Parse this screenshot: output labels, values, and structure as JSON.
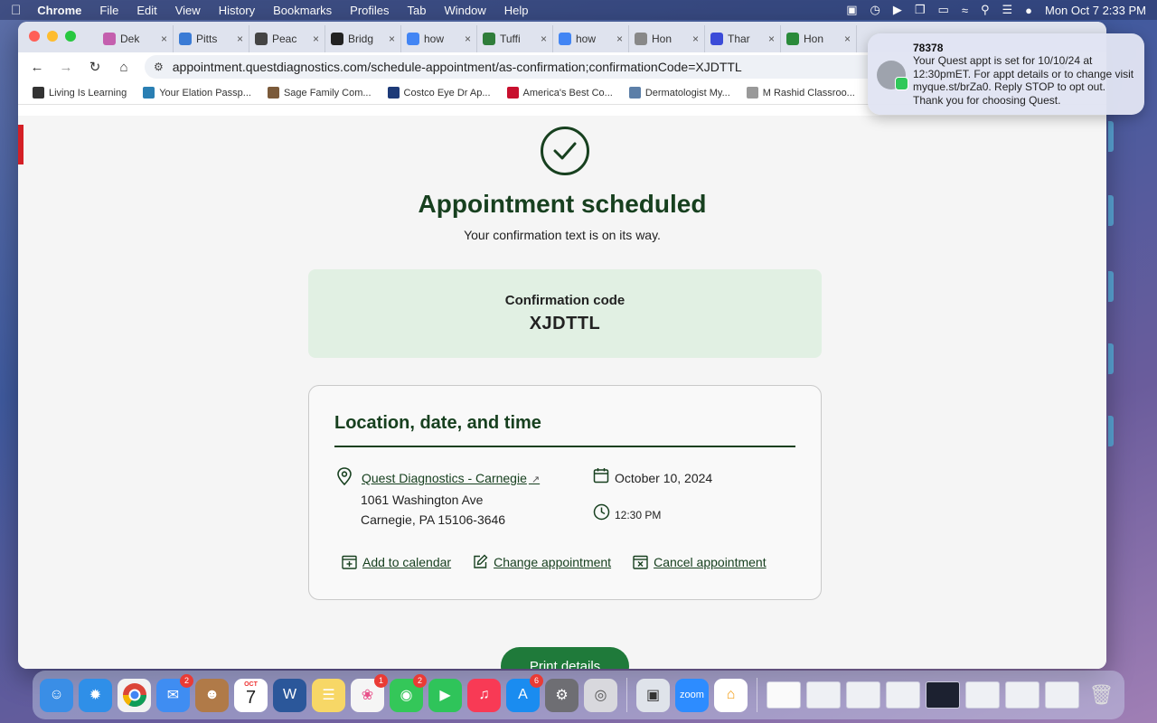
{
  "menubar": {
    "app_name": "Chrome",
    "menus": [
      "File",
      "Edit",
      "View",
      "History",
      "Bookmarks",
      "Profiles",
      "Tab",
      "Window",
      "Help"
    ],
    "clock": "Mon Oct 7  2:33 PM"
  },
  "browser": {
    "tabs": [
      {
        "title": "Dek",
        "fav_color": "#c45fae"
      },
      {
        "title": "Pitts",
        "fav_color": "#3a7bd5"
      },
      {
        "title": "Peac",
        "fav_color": "#444444"
      },
      {
        "title": "Bridg",
        "fav_color": "#222222"
      },
      {
        "title": "how",
        "fav_color": "#4285f4"
      },
      {
        "title": "Tuffi",
        "fav_color": "#2f7d3a"
      },
      {
        "title": "how",
        "fav_color": "#4285f4"
      },
      {
        "title": "Hon",
        "fav_color": "#888888"
      },
      {
        "title": "Thar",
        "fav_color": "#3b4bd8"
      },
      {
        "title": "Hon",
        "fav_color": "#2a8a3a"
      }
    ],
    "url": "appointment.questdiagnostics.com/schedule-appointment/as-confirmation;confirmationCode=XJDTTL",
    "bookmarks": [
      {
        "label": "Living Is Learning",
        "color": "#333333"
      },
      {
        "label": "Your Elation Passp...",
        "color": "#2a7fb3"
      },
      {
        "label": "Sage Family Com...",
        "color": "#7b5a3a"
      },
      {
        "label": "Costco Eye Dr Ap...",
        "color": "#1d3a78"
      },
      {
        "label": "America's Best Co...",
        "color": "#c8102e"
      },
      {
        "label": "Dermatologist My...",
        "color": "#5c7fa8"
      },
      {
        "label": "M Rashid Classroo...",
        "color": "#999999"
      }
    ]
  },
  "page": {
    "headline": "Appointment scheduled",
    "subline": "Your confirmation text is on its way.",
    "confirmation": {
      "label": "Confirmation code",
      "code": "XJDTTL"
    },
    "details": {
      "title": "Location, date, and time",
      "location_name": "Quest Diagnostics - Carnegie",
      "address_line1": "1061 Washington Ave",
      "address_line2": "Carnegie, PA 15106-3646",
      "date": "October 10, 2024",
      "time": "12:30 PM",
      "actions": {
        "add_calendar": "Add to calendar",
        "change": "Change appointment",
        "cancel": "Cancel appointment"
      }
    },
    "print_button": "Print details"
  },
  "notification": {
    "sender": "78378",
    "body": "Your Quest appt is set for 10/10/24 at 12:30pmET. For appt details or to change visit myque.st/brZa0. Reply STOP to opt out. Thank you for choosing Quest."
  },
  "dock": {
    "mail_badge": "2",
    "calendar_month": "OCT",
    "calendar_day": "7",
    "photos_badge": "1",
    "messages_badge": "2",
    "appstore_badge": "6",
    "zoom_label": "zoom"
  },
  "colors": {
    "brand_green": "#17401f",
    "button_green": "#1f7a3a",
    "confirm_bg": "#e1f0e3"
  }
}
